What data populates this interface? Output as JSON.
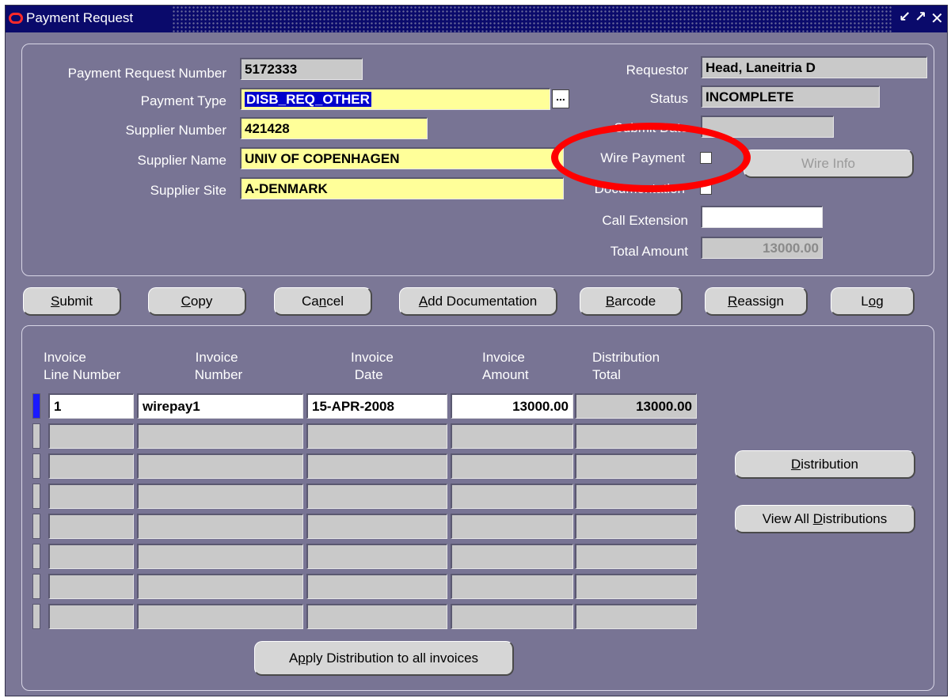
{
  "window": {
    "title": "Payment Request",
    "controls": [
      "minimize-icon",
      "maximize-icon",
      "close-icon"
    ]
  },
  "header": {
    "payment_request_number_label": "Payment Request Number",
    "payment_request_number": "5172333",
    "payment_type_label": "Payment Type",
    "payment_type": "DISB_REQ_OTHER",
    "supplier_number_label": "Supplier Number",
    "supplier_number": "421428",
    "supplier_name_label": "Supplier Name",
    "supplier_name": "UNIV OF COPENHAGEN",
    "supplier_site_label": "Supplier Site",
    "supplier_site": "A-DENMARK",
    "requestor_label": "Requestor",
    "requestor": "Head, Laneitria D",
    "status_label": "Status",
    "status": "INCOMPLETE",
    "submit_date_label": "Submit Date",
    "submit_date": "",
    "wire_payment_label": "Wire Payment",
    "wire_payment_checked": false,
    "documentation_label": "Documentation",
    "documentation_checked": false,
    "wire_info_button": "Wire Info",
    "call_extension_label": "Call Extension",
    "call_extension": "",
    "total_amount_label": "Total Amount",
    "total_amount": "13000.00"
  },
  "toolbar": {
    "submit": {
      "pre": "",
      "key": "S",
      "post": "ubmit"
    },
    "copy": {
      "pre": "",
      "key": "C",
      "post": "opy"
    },
    "cancel": {
      "pre": "Ca",
      "key": "n",
      "post": "cel"
    },
    "add_documentation": {
      "pre": "",
      "key": "A",
      "post": "dd Documentation"
    },
    "barcode": {
      "pre": "",
      "key": "B",
      "post": "arcode"
    },
    "reassign": {
      "pre": "",
      "key": "R",
      "post": "eassign"
    },
    "log": {
      "pre": "L",
      "key": "o",
      "post": "g"
    }
  },
  "invoices": {
    "columns": [
      {
        "line1": "Invoice",
        "line2": "Line Number"
      },
      {
        "line1": "Invoice",
        "line2": "Number"
      },
      {
        "line1": "Invoice",
        "line2": "Date"
      },
      {
        "line1": "Invoice",
        "line2": "Amount"
      },
      {
        "line1": "Distribution",
        "line2": "Total"
      }
    ],
    "rows": [
      [
        "1",
        "wirepay1",
        "15-APR-2008",
        "13000.00",
        "13000.00"
      ],
      [
        "",
        "",
        "",
        "",
        ""
      ],
      [
        "",
        "",
        "",
        "",
        ""
      ],
      [
        "",
        "",
        "",
        "",
        ""
      ],
      [
        "",
        "",
        "",
        "",
        ""
      ],
      [
        "",
        "",
        "",
        "",
        ""
      ],
      [
        "",
        "",
        "",
        "",
        ""
      ],
      [
        "",
        "",
        "",
        "",
        ""
      ]
    ]
  },
  "side_buttons": {
    "distribution": {
      "pre": "",
      "key": "D",
      "post": "istribution"
    },
    "view_all": {
      "pre": "View All ",
      "key": "D",
      "post": "istributions"
    }
  },
  "apply_button": {
    "pre": "A",
    "key": "p",
    "post": "ply Distribution to all invoices"
  },
  "annotation": {
    "color": "#ff0000",
    "highlights": "Wire Payment"
  },
  "colors": {
    "window_bg": "#7b7796",
    "field_gray": "#c9c9c9",
    "field_yellow": "#ffff99",
    "selection": "#0000cc",
    "current_row": "#1a1aff"
  }
}
